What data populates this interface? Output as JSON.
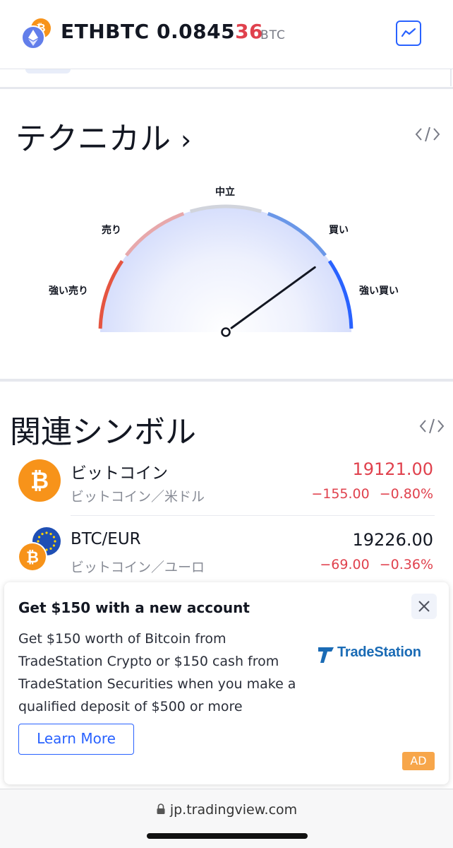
{
  "header": {
    "symbol": "ETHBTC",
    "price_main": "0.0845",
    "price_highlight": "36",
    "price_unit": "BTC",
    "icons": {
      "base": "ethereum-icon",
      "quote": "bitcoin-icon",
      "chart": "chart-line-icon"
    }
  },
  "technicals": {
    "title": "テクニカル",
    "chevron": "›",
    "gauge": {
      "labels": {
        "strong_sell": "強い売り",
        "sell": "売り",
        "neutral": "中立",
        "buy": "買い",
        "strong_buy": "強い買い"
      },
      "needle_level": 0.8,
      "colors": {
        "strong_sell": "#e55541",
        "sell": "#e7a8ab",
        "neutral": "#d1d4dc",
        "buy": "#6a97e8",
        "strong_buy": "#2962ff"
      }
    }
  },
  "related": {
    "title": "関連シンボル",
    "items": [
      {
        "name": "ビットコイン",
        "desc": "ビットコイン／米ドル",
        "last": "19121.00",
        "change": "−155.00",
        "change_pct": "−0.80%",
        "last_color": "#e0414d"
      },
      {
        "name": "BTC/EUR",
        "desc": "ビットコイン／ユーロ",
        "last": "19226.00",
        "change": "−69.00",
        "change_pct": "−0.36%",
        "last_color": "#131722"
      }
    ]
  },
  "ad": {
    "title": "Get $150 with a new account",
    "body": "Get $150 worth of Bitcoin from TradeStation Crypto or $150 cash from TradeStation Securities when you make a qualified deposit of $500 or more",
    "brand": "TradeStation",
    "cta": "Learn More",
    "badge": "AD"
  },
  "browser": {
    "url": "jp.tradingview.com"
  },
  "colors": {
    "accent": "#2962ff",
    "negative": "#e0414d",
    "bitcoin": "#f7931a",
    "ethereum": "#627eea"
  }
}
